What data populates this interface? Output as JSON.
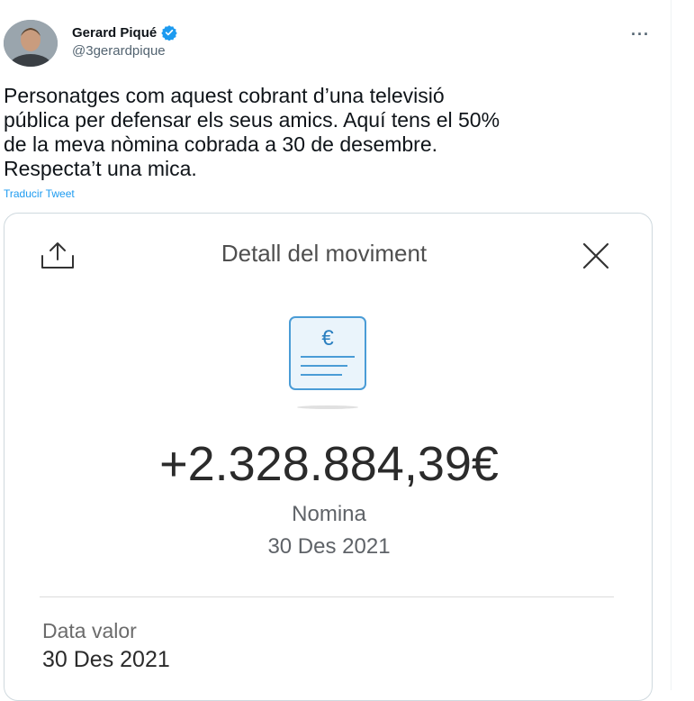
{
  "tweet": {
    "author_name": "Gerard Piqué",
    "handle": "@3gerardpique",
    "more_label": "···",
    "text": "Personatges com aquest cobrant d’una televisió\npública per defensar els seus amics. Aquí tens el 50%\nde la meva nòmina cobrada a 30 de desembre.\nRespecta’t una mica.",
    "translate_label": "Traducir Tweet"
  },
  "card": {
    "title": "Detall del moviment",
    "amount": "+2.328.884,39€",
    "concept": "Nomina",
    "date": "30 Des 2021",
    "value_label": "Data valor",
    "value_date": "30 Des 2021",
    "doc_symbol": "€"
  },
  "icons": {
    "share": "share-icon",
    "close": "close-icon",
    "verified": "verified-badge-icon",
    "document": "payslip-document-icon"
  },
  "colors": {
    "verified": "#1d9bf0",
    "link": "#1d9bf0",
    "doc_stroke": "#4a9cd6",
    "doc_fill": "#eaf4fb"
  }
}
